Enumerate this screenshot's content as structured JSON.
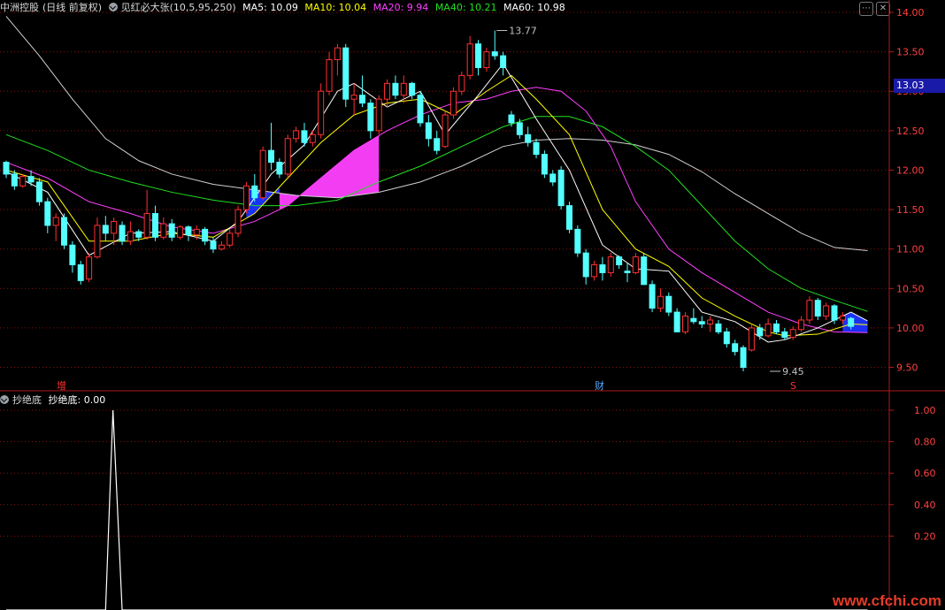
{
  "header": {
    "stock": "中洲控股",
    "period": "(日线 前复权)",
    "indicator": "见红必大张(10,5,95,250)",
    "ma": [
      {
        "label": "MA5: 10.09",
        "color": "#ffffff"
      },
      {
        "label": "MA10: 10.04",
        "color": "#ffff00"
      },
      {
        "label": "MA20: 9.94",
        "color": "#ff40ff"
      },
      {
        "label": "MA40: 10.21",
        "color": "#20e020"
      },
      {
        "label": "MA60: 10.98",
        "color": "#ffffff"
      }
    ]
  },
  "sub_header": {
    "name": "抄绝底",
    "value_label": "抄绝底: 0.00"
  },
  "markers": {
    "zeng": "增",
    "cai": "财",
    "s": "S"
  },
  "price_tag": "13.03",
  "annotations": {
    "high": "13.77",
    "low": "9.45"
  },
  "watermark": "www.cfchi.com",
  "axis": {
    "main_ticks": [
      "14.00",
      "13.50",
      "13.00",
      "12.50",
      "12.00",
      "11.50",
      "11.00",
      "10.50",
      "10.00",
      "9.50"
    ],
    "sub_ticks": [
      "1.00",
      "0.80",
      "0.60",
      "0.40",
      "0.20"
    ]
  },
  "colors": {
    "up": "#ff3030",
    "down": "#54ffff",
    "grid": "#8a1010",
    "axis": "#b01818",
    "ma5": "#ffffff",
    "ma10": "#ffff00",
    "ma20": "#ff40ff",
    "ma40": "#20e020",
    "ma60": "#d0d0d0",
    "signal": "#ffffff"
  },
  "chart_data": {
    "type": "candlestick",
    "price_range": [
      9.3,
      14.2
    ],
    "candles": [
      {
        "o": 12.1,
        "h": 12.12,
        "l": 11.9,
        "c": 11.95
      },
      {
        "o": 11.95,
        "h": 12.0,
        "l": 11.75,
        "c": 11.8
      },
      {
        "o": 11.8,
        "h": 11.95,
        "l": 11.78,
        "c": 11.92
      },
      {
        "o": 11.92,
        "h": 12.0,
        "l": 11.8,
        "c": 11.85
      },
      {
        "o": 11.85,
        "h": 11.9,
        "l": 11.55,
        "c": 11.6
      },
      {
        "o": 11.6,
        "h": 11.65,
        "l": 11.2,
        "c": 11.3
      },
      {
        "o": 11.3,
        "h": 11.45,
        "l": 11.1,
        "c": 11.4
      },
      {
        "o": 11.4,
        "h": 11.45,
        "l": 11.0,
        "c": 11.05
      },
      {
        "o": 11.05,
        "h": 11.1,
        "l": 10.7,
        "c": 10.8
      },
      {
        "o": 10.8,
        "h": 10.85,
        "l": 10.55,
        "c": 10.6
      },
      {
        "o": 10.62,
        "h": 10.95,
        "l": 10.58,
        "c": 10.9
      },
      {
        "o": 10.9,
        "h": 11.4,
        "l": 10.88,
        "c": 11.3
      },
      {
        "o": 11.3,
        "h": 11.42,
        "l": 11.1,
        "c": 11.2
      },
      {
        "o": 11.2,
        "h": 11.4,
        "l": 11.05,
        "c": 11.35
      },
      {
        "o": 11.3,
        "h": 11.35,
        "l": 11.05,
        "c": 11.1
      },
      {
        "o": 11.1,
        "h": 11.35,
        "l": 11.05,
        "c": 11.22
      },
      {
        "o": 11.22,
        "h": 11.25,
        "l": 11.1,
        "c": 11.15
      },
      {
        "o": 11.15,
        "h": 11.75,
        "l": 11.12,
        "c": 11.45
      },
      {
        "o": 11.45,
        "h": 11.55,
        "l": 11.1,
        "c": 11.15
      },
      {
        "o": 11.15,
        "h": 11.4,
        "l": 11.12,
        "c": 11.32
      },
      {
        "o": 11.32,
        "h": 11.38,
        "l": 11.1,
        "c": 11.15
      },
      {
        "o": 11.15,
        "h": 11.3,
        "l": 11.12,
        "c": 11.28
      },
      {
        "o": 11.28,
        "h": 11.3,
        "l": 11.1,
        "c": 11.18
      },
      {
        "o": 11.18,
        "h": 11.3,
        "l": 11.12,
        "c": 11.25
      },
      {
        "o": 11.25,
        "h": 11.28,
        "l": 11.05,
        "c": 11.1
      },
      {
        "o": 11.1,
        "h": 11.15,
        "l": 10.95,
        "c": 11.0
      },
      {
        "o": 11.0,
        "h": 11.1,
        "l": 10.98,
        "c": 11.05
      },
      {
        "o": 11.05,
        "h": 11.25,
        "l": 11.02,
        "c": 11.2
      },
      {
        "o": 11.2,
        "h": 11.55,
        "l": 11.15,
        "c": 11.5
      },
      {
        "o": 11.5,
        "h": 11.85,
        "l": 11.45,
        "c": 11.8
      },
      {
        "o": 11.8,
        "h": 11.95,
        "l": 11.6,
        "c": 11.65
      },
      {
        "o": 11.65,
        "h": 12.3,
        "l": 11.62,
        "c": 12.25
      },
      {
        "o": 12.25,
        "h": 12.6,
        "l": 12.0,
        "c": 12.1
      },
      {
        "o": 12.1,
        "h": 12.15,
        "l": 11.9,
        "c": 11.95
      },
      {
        "o": 11.95,
        "h": 12.45,
        "l": 11.9,
        "c": 12.4
      },
      {
        "o": 12.4,
        "h": 12.55,
        "l": 12.35,
        "c": 12.5
      },
      {
        "o": 12.5,
        "h": 12.6,
        "l": 12.3,
        "c": 12.35
      },
      {
        "o": 12.35,
        "h": 12.5,
        "l": 12.3,
        "c": 12.45
      },
      {
        "o": 12.45,
        "h": 13.1,
        "l": 12.4,
        "c": 13.0
      },
      {
        "o": 13.0,
        "h": 13.5,
        "l": 12.95,
        "c": 13.4
      },
      {
        "o": 13.4,
        "h": 13.6,
        "l": 13.2,
        "c": 13.55
      },
      {
        "o": 13.55,
        "h": 13.6,
        "l": 12.8,
        "c": 12.9
      },
      {
        "o": 12.9,
        "h": 13.1,
        "l": 12.7,
        "c": 12.95
      },
      {
        "o": 12.95,
        "h": 13.2,
        "l": 12.8,
        "c": 12.85
      },
      {
        "o": 12.85,
        "h": 12.9,
        "l": 12.4,
        "c": 12.5
      },
      {
        "o": 12.5,
        "h": 12.95,
        "l": 12.45,
        "c": 12.9
      },
      {
        "o": 12.9,
        "h": 13.15,
        "l": 12.8,
        "c": 13.1
      },
      {
        "o": 13.1,
        "h": 13.2,
        "l": 12.9,
        "c": 12.95
      },
      {
        "o": 12.95,
        "h": 13.2,
        "l": 12.85,
        "c": 13.1
      },
      {
        "o": 13.1,
        "h": 13.12,
        "l": 12.9,
        "c": 12.95
      },
      {
        "o": 12.95,
        "h": 13.0,
        "l": 12.55,
        "c": 12.6
      },
      {
        "o": 12.6,
        "h": 12.7,
        "l": 12.3,
        "c": 12.4
      },
      {
        "o": 12.4,
        "h": 12.5,
        "l": 12.2,
        "c": 12.25
      },
      {
        "o": 12.3,
        "h": 12.75,
        "l": 12.28,
        "c": 12.7
      },
      {
        "o": 12.7,
        "h": 13.05,
        "l": 12.65,
        "c": 13.0
      },
      {
        "o": 13.0,
        "h": 13.25,
        "l": 12.95,
        "c": 13.2
      },
      {
        "o": 13.2,
        "h": 13.7,
        "l": 13.15,
        "c": 13.6
      },
      {
        "o": 13.6,
        "h": 13.65,
        "l": 13.2,
        "c": 13.3
      },
      {
        "o": 13.3,
        "h": 13.55,
        "l": 13.25,
        "c": 13.5
      },
      {
        "o": 13.5,
        "h": 13.77,
        "l": 13.4,
        "c": 13.45
      },
      {
        "o": 13.45,
        "h": 13.5,
        "l": 13.2,
        "c": 13.3
      },
      {
        "o": 12.7,
        "h": 12.75,
        "l": 12.55,
        "c": 12.6
      },
      {
        "o": 12.6,
        "h": 12.65,
        "l": 12.4,
        "c": 12.45
      },
      {
        "o": 12.45,
        "h": 12.55,
        "l": 12.3,
        "c": 12.35
      },
      {
        "o": 12.35,
        "h": 12.4,
        "l": 12.15,
        "c": 12.2
      },
      {
        "o": 12.2,
        "h": 12.25,
        "l": 11.9,
        "c": 11.95
      },
      {
        "o": 11.95,
        "h": 12.0,
        "l": 11.8,
        "c": 11.85
      },
      {
        "o": 12.0,
        "h": 12.05,
        "l": 11.5,
        "c": 11.55
      },
      {
        "o": 11.55,
        "h": 11.6,
        "l": 11.2,
        "c": 11.25
      },
      {
        "o": 11.25,
        "h": 11.3,
        "l": 10.9,
        "c": 10.95
      },
      {
        "o": 10.95,
        "h": 11.0,
        "l": 10.55,
        "c": 10.65
      },
      {
        "o": 10.65,
        "h": 10.85,
        "l": 10.6,
        "c": 10.8
      },
      {
        "o": 10.8,
        "h": 10.9,
        "l": 10.6,
        "c": 10.7
      },
      {
        "o": 10.7,
        "h": 10.95,
        "l": 10.65,
        "c": 10.9
      },
      {
        "o": 10.9,
        "h": 10.92,
        "l": 10.75,
        "c": 10.8
      },
      {
        "o": 10.72,
        "h": 10.82,
        "l": 10.58,
        "c": 10.7
      },
      {
        "o": 10.7,
        "h": 10.95,
        "l": 10.68,
        "c": 10.9
      },
      {
        "o": 10.9,
        "h": 10.95,
        "l": 10.55,
        "c": 10.55
      },
      {
        "o": 10.55,
        "h": 10.6,
        "l": 10.2,
        "c": 10.25
      },
      {
        "o": 10.25,
        "h": 10.5,
        "l": 10.2,
        "c": 10.4
      },
      {
        "o": 10.4,
        "h": 10.45,
        "l": 10.15,
        "c": 10.2
      },
      {
        "o": 10.2,
        "h": 10.25,
        "l": 9.95,
        "c": 9.95
      },
      {
        "o": 9.95,
        "h": 10.2,
        "l": 9.92,
        "c": 10.15
      },
      {
        "o": 10.12,
        "h": 10.25,
        "l": 10.05,
        "c": 10.08
      },
      {
        "o": 10.08,
        "h": 10.15,
        "l": 10.0,
        "c": 10.05
      },
      {
        "o": 10.05,
        "h": 10.15,
        "l": 9.95,
        "c": 10.1
      },
      {
        "o": 10.05,
        "h": 10.1,
        "l": 9.92,
        "c": 9.95
      },
      {
        "o": 9.95,
        "h": 10.0,
        "l": 9.75,
        "c": 9.8
      },
      {
        "o": 9.8,
        "h": 9.85,
        "l": 9.65,
        "c": 9.7
      },
      {
        "o": 9.75,
        "h": 9.78,
        "l": 9.45,
        "c": 9.5
      },
      {
        "o": 9.72,
        "h": 10.05,
        "l": 9.7,
        "c": 10.0
      },
      {
        "o": 10.0,
        "h": 10.05,
        "l": 9.85,
        "c": 9.9
      },
      {
        "o": 9.9,
        "h": 10.12,
        "l": 9.88,
        "c": 10.05
      },
      {
        "o": 10.05,
        "h": 10.1,
        "l": 9.92,
        "c": 9.95
      },
      {
        "o": 9.95,
        "h": 10.0,
        "l": 9.85,
        "c": 9.88
      },
      {
        "o": 9.88,
        "h": 10.02,
        "l": 9.85,
        "c": 9.98
      },
      {
        "o": 9.98,
        "h": 10.15,
        "l": 9.95,
        "c": 10.1
      },
      {
        "o": 10.1,
        "h": 10.4,
        "l": 10.05,
        "c": 10.35
      },
      {
        "o": 10.35,
        "h": 10.38,
        "l": 10.1,
        "c": 10.15
      },
      {
        "o": 10.15,
        "h": 10.32,
        "l": 10.1,
        "c": 10.28
      },
      {
        "o": 10.28,
        "h": 10.3,
        "l": 10.05,
        "c": 10.1
      },
      {
        "o": 10.1,
        "h": 10.2,
        "l": 10.05,
        "c": 10.15
      },
      {
        "o": 10.12,
        "h": 10.14,
        "l": 9.98,
        "c": 10.02
      }
    ],
    "ma5": [
      [
        0,
        11.98
      ],
      [
        5,
        11.72
      ],
      [
        10,
        10.92
      ],
      [
        15,
        11.2
      ],
      [
        20,
        11.22
      ],
      [
        25,
        11.1
      ],
      [
        28,
        11.35
      ],
      [
        32,
        11.95
      ],
      [
        36,
        12.32
      ],
      [
        40,
        13.0
      ],
      [
        42,
        13.1
      ],
      [
        46,
        12.8
      ],
      [
        50,
        13.0
      ],
      [
        53,
        12.45
      ],
      [
        57,
        12.95
      ],
      [
        60,
        13.35
      ],
      [
        64,
        12.65
      ],
      [
        68,
        12.0
      ],
      [
        72,
        11.05
      ],
      [
        76,
        10.75
      ],
      [
        80,
        10.72
      ],
      [
        84,
        10.2
      ],
      [
        88,
        10.08
      ],
      [
        92,
        9.82
      ],
      [
        94,
        9.85
      ],
      [
        98,
        10.0
      ],
      [
        102,
        10.2
      ],
      [
        104,
        10.09
      ]
    ],
    "ma10": [
      [
        0,
        12.0
      ],
      [
        5,
        11.85
      ],
      [
        10,
        11.1
      ],
      [
        15,
        11.1
      ],
      [
        20,
        11.2
      ],
      [
        25,
        11.15
      ],
      [
        30,
        11.45
      ],
      [
        34,
        11.9
      ],
      [
        38,
        12.35
      ],
      [
        42,
        12.7
      ],
      [
        46,
        12.85
      ],
      [
        50,
        12.9
      ],
      [
        54,
        12.7
      ],
      [
        58,
        13.0
      ],
      [
        61,
        13.2
      ],
      [
        64,
        12.9
      ],
      [
        68,
        12.45
      ],
      [
        72,
        11.5
      ],
      [
        76,
        11.0
      ],
      [
        80,
        10.78
      ],
      [
        84,
        10.38
      ],
      [
        88,
        10.15
      ],
      [
        92,
        9.95
      ],
      [
        94,
        9.9
      ],
      [
        98,
        9.92
      ],
      [
        102,
        10.05
      ],
      [
        104,
        10.04
      ]
    ],
    "ma20": [
      [
        0,
        12.1
      ],
      [
        5,
        11.9
      ],
      [
        10,
        11.6
      ],
      [
        15,
        11.45
      ],
      [
        20,
        11.28
      ],
      [
        25,
        11.2
      ],
      [
        30,
        11.35
      ],
      [
        34,
        11.55
      ],
      [
        38,
        11.9
      ],
      [
        42,
        12.25
      ],
      [
        46,
        12.5
      ],
      [
        50,
        12.7
      ],
      [
        54,
        12.85
      ],
      [
        58,
        12.9
      ],
      [
        61,
        13.0
      ],
      [
        64,
        13.05
      ],
      [
        67,
        13.0
      ],
      [
        70,
        12.75
      ],
      [
        73,
        12.3
      ],
      [
        76,
        11.6
      ],
      [
        80,
        11.0
      ],
      [
        84,
        10.7
      ],
      [
        88,
        10.45
      ],
      [
        92,
        10.2
      ],
      [
        96,
        10.05
      ],
      [
        100,
        9.95
      ],
      [
        104,
        9.94
      ]
    ],
    "ma40": [
      [
        0,
        12.45
      ],
      [
        5,
        12.25
      ],
      [
        10,
        12.0
      ],
      [
        15,
        11.85
      ],
      [
        20,
        11.72
      ],
      [
        25,
        11.62
      ],
      [
        30,
        11.55
      ],
      [
        35,
        11.55
      ],
      [
        40,
        11.62
      ],
      [
        45,
        11.85
      ],
      [
        50,
        12.05
      ],
      [
        55,
        12.3
      ],
      [
        60,
        12.55
      ],
      [
        64,
        12.68
      ],
      [
        68,
        12.68
      ],
      [
        72,
        12.55
      ],
      [
        76,
        12.3
      ],
      [
        80,
        12.0
      ],
      [
        84,
        11.55
      ],
      [
        88,
        11.1
      ],
      [
        92,
        10.75
      ],
      [
        96,
        10.5
      ],
      [
        100,
        10.35
      ],
      [
        104,
        10.21
      ]
    ],
    "ma60": [
      [
        0,
        13.95
      ],
      [
        4,
        13.45
      ],
      [
        8,
        12.9
      ],
      [
        12,
        12.4
      ],
      [
        16,
        12.12
      ],
      [
        20,
        11.95
      ],
      [
        25,
        11.82
      ],
      [
        30,
        11.75
      ],
      [
        35,
        11.68
      ],
      [
        40,
        11.65
      ],
      [
        45,
        11.72
      ],
      [
        50,
        11.85
      ],
      [
        55,
        12.05
      ],
      [
        60,
        12.3
      ],
      [
        64,
        12.38
      ],
      [
        68,
        12.4
      ],
      [
        72,
        12.38
      ],
      [
        76,
        12.32
      ],
      [
        80,
        12.2
      ],
      [
        84,
        11.98
      ],
      [
        88,
        11.7
      ],
      [
        92,
        11.45
      ],
      [
        96,
        11.2
      ],
      [
        100,
        11.02
      ],
      [
        104,
        10.98
      ]
    ],
    "signal": {
      "name": "抄绝底",
      "range": [
        0,
        1.05
      ],
      "values": [
        [
          0,
          0
        ],
        [
          12,
          0
        ],
        [
          13,
          1
        ],
        [
          14,
          0
        ],
        [
          104,
          0
        ]
      ]
    }
  }
}
